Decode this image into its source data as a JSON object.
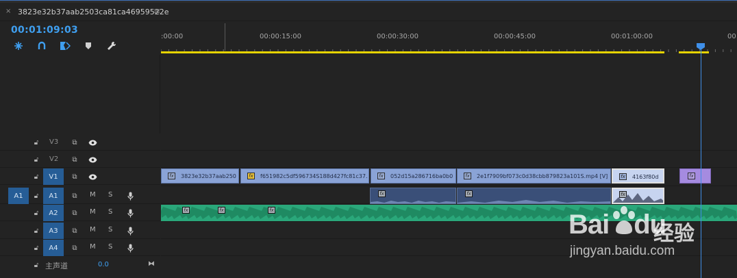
{
  "sequence": {
    "tab_title": "3823e32b37aab2503ca81ca46959522e",
    "close_glyph": "×",
    "menu_glyph": "≡",
    "timecode": "00:01:09:03"
  },
  "toolbar": {
    "icons": [
      "snap-icon",
      "linked-selection-icon",
      "add-marker-icon",
      "marker-icon",
      "wrench-icon"
    ]
  },
  "ruler": {
    "labels": [
      ":00:00",
      "00:00:15:00",
      "00:00:30:00",
      "00:00:45:00",
      "00:01:00:00",
      "00"
    ]
  },
  "tracks": {
    "video": [
      {
        "id": "V3",
        "label": "V3"
      },
      {
        "id": "V2",
        "label": "V2"
      },
      {
        "id": "V1",
        "label": "V1",
        "targeted": true
      }
    ],
    "audio": [
      {
        "id": "A1",
        "label": "A1",
        "source": "A1",
        "m": "M",
        "s": "S"
      },
      {
        "id": "A2",
        "label": "A2",
        "m": "M",
        "s": "S"
      },
      {
        "id": "A3",
        "label": "A3",
        "m": "M",
        "s": "S"
      },
      {
        "id": "A4",
        "label": "A4",
        "m": "M",
        "s": "S"
      }
    ],
    "master_label": "主声道",
    "master_value": "0.0"
  },
  "clips": {
    "v1": [
      {
        "name": "3823e32b37aab250",
        "fx": "fx"
      },
      {
        "name": "f651982c5df596734S188d427fc81c37.",
        "fx": "fx"
      },
      {
        "name": "052d15a286716ba0b0",
        "fx": "fx"
      },
      {
        "name": "2e1f7909bf073c0d38cbb879823a101S.mp4 [V]",
        "fx": "fx"
      },
      {
        "name": "4163f80d",
        "fx": "fx"
      },
      {
        "name": "",
        "fx": "fx"
      }
    ],
    "fx_label": "fx"
  },
  "watermark": {
    "logo": "Bai",
    "logo_tail": "du",
    "cn": "经验",
    "url": "jingyan.baidu.com"
  },
  "colors": {
    "accent": "#3f9ff0",
    "workbar": "#e6d300",
    "video_clip": "#8aa3d6",
    "audio_clip": "#2aa77a",
    "target": "#265d96"
  }
}
